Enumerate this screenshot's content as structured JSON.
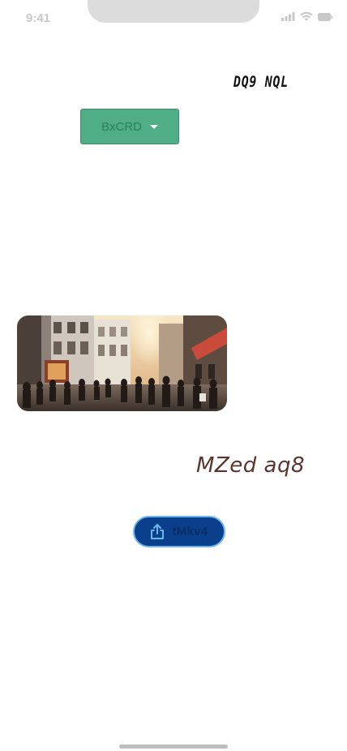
{
  "status_bar": {
    "time": "9:41",
    "icons": [
      "signal-icon",
      "wifi-icon",
      "battery-icon"
    ],
    "icon_color": "#c8c8c8"
  },
  "title": "DQ9 NQL",
  "dropdown": {
    "label": "BxCRD",
    "icon": "caret-down-icon",
    "background": "#4fae86"
  },
  "photo": {
    "subject": "city-street-crowd-photo"
  },
  "caption": "MZed aq8",
  "share_button": {
    "label": "tMkv4",
    "icon": "share-icon",
    "background": "#0a3f8c",
    "border": "#6db4ea"
  }
}
